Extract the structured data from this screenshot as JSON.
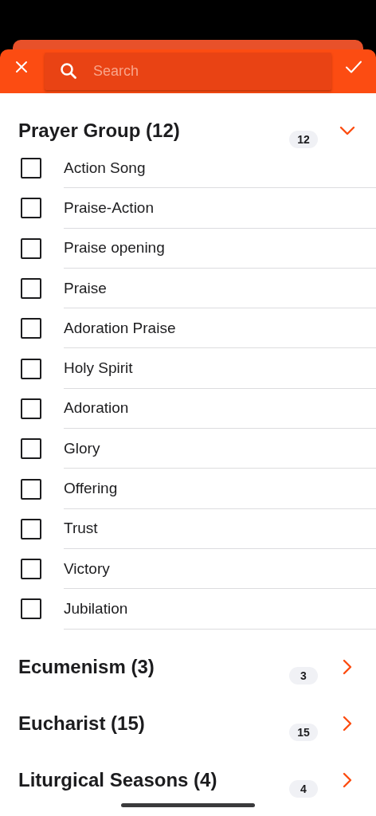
{
  "search": {
    "placeholder": "Search"
  },
  "groups": [
    {
      "title": "Prayer Group (12)",
      "count": "12",
      "expanded": true,
      "items": [
        {
          "label": "Action Song",
          "checked": false
        },
        {
          "label": "Praise-Action",
          "checked": false
        },
        {
          "label": "Praise opening",
          "checked": false
        },
        {
          "label": "Praise",
          "checked": false
        },
        {
          "label": "Adoration Praise",
          "checked": false
        },
        {
          "label": "Holy Spirit",
          "checked": false
        },
        {
          "label": "Adoration",
          "checked": false
        },
        {
          "label": "Glory",
          "checked": false
        },
        {
          "label": "Offering",
          "checked": false
        },
        {
          "label": "Trust",
          "checked": false
        },
        {
          "label": "Victory",
          "checked": false
        },
        {
          "label": "Jubilation",
          "checked": false
        }
      ]
    },
    {
      "title": "Ecumenism (3)",
      "count": "3",
      "expanded": false
    },
    {
      "title": "Eucharist (15)",
      "count": "15",
      "expanded": false
    },
    {
      "title": "Liturgical Seasons (4)",
      "count": "4",
      "expanded": false
    }
  ]
}
